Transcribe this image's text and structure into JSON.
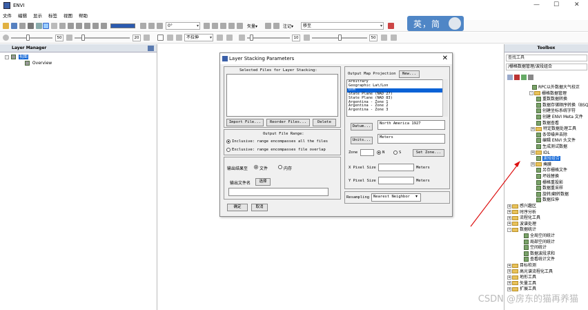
{
  "window": {
    "title": "ENVI",
    "minimize": "—",
    "maximize": "☐",
    "close": "✕"
  },
  "menu": [
    "文件",
    "编辑",
    "显示",
    "标签",
    "视图",
    "帮助"
  ],
  "toolbar1": {
    "rotation": "0°",
    "vector_label": "矢量▾",
    "annot_label": "注记▾",
    "basemap": "移至"
  },
  "toolbar2": {
    "v1": "50",
    "v2": "20",
    "v3": "10",
    "v4": "50",
    "stretch": "不拉伸"
  },
  "ime": {
    "text": "英，简"
  },
  "layer_manager": {
    "title": "Layer Manager",
    "root": "视图",
    "child": "Overview"
  },
  "toolbox": {
    "title": "Toolbox",
    "search": "查找工具",
    "path": "/栅格数据管理/波段组合",
    "items": [
      "RPC以外数据大气校正",
      "栅格数据管理",
      "重数数据转换",
      "数据存储顺序转换（BSQ, BIL",
      "创建坐标系统字符",
      "创建 ENVI Meta 文件",
      "数据查看",
      "特定数据处理工具",
      "条带噪声去除",
      "编辑 ENVI 头文件",
      "生成测试数据",
      "IDL",
      "波段组合",
      "掩膜",
      "另存栅格文件",
      "坏线替换",
      "栅格重投影",
      "数据重采样",
      "旋转/翻转数据",
      "数据拉伸",
      "感兴趣区",
      "时序分析",
      "流程化工具",
      "波谱处理",
      "数据统计",
      "全局空间统计",
      "局部空间统计",
      "空间统计",
      "数据波段求和",
      "查看统计文件",
      "目标检测",
      "高光谱流程化工具",
      "地形工具",
      "矢量工具",
      "扩展工具"
    ]
  },
  "dialog": {
    "title": "Layer Stacking Parameters",
    "selected_files_label": "Selected Files for Layer Stacking:",
    "import_btn": "Import File...",
    "reorder_btn": "Reorder Files...",
    "delete_btn": "Delete",
    "output_range_label": "Output File Range:",
    "inclusive": "Inclusive: range encompasses all the files",
    "exclusive": "Exclusive: range encompasses file overlap",
    "output_to": "输出结果至",
    "file_opt": "文件",
    "memory_opt": "内存",
    "output_name": "输出文件名",
    "choose_btn": "选择",
    "ok_btn": "确定",
    "cancel_btn": "取消",
    "projection_label": "Output Map Projection",
    "new_btn": "New...",
    "projections": [
      "Arbitrary",
      "Geographic Lat/Lon",
      "UTM",
      "State Plane (NAD 27)",
      "State Plane (NAD 83)",
      "Argentina - Zone 1",
      "Argentina - Zone 2",
      "Argentina - Zone 3"
    ],
    "selected_projection": "UTM",
    "datum_btn": "Datum...",
    "datum_value": "North America 1927",
    "units_btn": "Units...",
    "units_value": "Meters",
    "zone_label": "Zone",
    "zone_value": "",
    "n_label": "N",
    "s_label": "S",
    "setzone_btn": "Set Zone...",
    "xpixel_label": "X Pixel Size",
    "ypixel_label": "Y Pixel Size",
    "xpixel_unit": "Meters",
    "ypixel_unit": "Meters",
    "resampling_label": "Resampling",
    "resampling_value": "Nearest Neighbor"
  },
  "watermark": "CSDN @房东的猫再养猫"
}
